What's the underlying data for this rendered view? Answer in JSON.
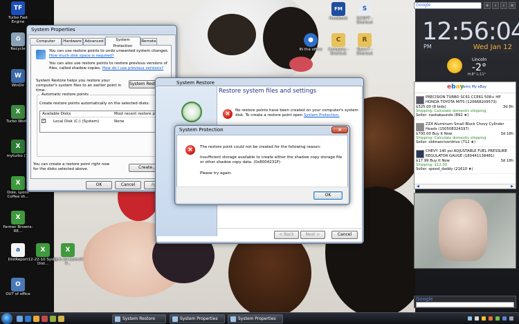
{
  "desktop": {
    "left_icons": [
      {
        "label": "Turbo Fast Engine",
        "color": "#1c4fb8",
        "glyph": "TF"
      },
      {
        "label": "Recycle",
        "color": "#8aa2b8",
        "glyph": "♻"
      },
      {
        "label": "WinDir",
        "color": "#3b6aa8",
        "glyph": "W"
      },
      {
        "label": "Turbo Works",
        "color": "#3b8a3f",
        "glyph": "X"
      },
      {
        "label": "myturbo (1)",
        "color": "#2f7a36",
        "glyph": "X"
      },
      {
        "label": "Dole, Lyons Coffee sh...",
        "color": "#3f9a3d",
        "glyph": "X"
      },
      {
        "label": "Farmer Browns-RE...",
        "color": "#3f9a3d",
        "glyph": "X"
      },
      {
        "label": "DistReport",
        "color": "#f4f4f4",
        "glyph": "a"
      },
      {
        "label": "12-22-10 Sysco Dist...",
        "color": "#3f9a3d",
        "glyph": "X"
      },
      {
        "label": "11-6-10 Eurovill P...",
        "color": "#3f9a3d",
        "glyph": "X"
      },
      {
        "label": "OUT of office",
        "color": "#4a79b5",
        "glyph": "O"
      }
    ],
    "top_icons": [
      {
        "label": "Foodbook",
        "glyph": "FM"
      },
      {
        "label": "SCRIPT - Shortcut",
        "glyph": "S"
      },
      {
        "label": "IN the office",
        "glyph": "●"
      },
      {
        "label": "Company - Shortcut",
        "glyph": "C"
      },
      {
        "label": "Ryan-T - Shortcut",
        "glyph": "R"
      }
    ]
  },
  "sidebar": {
    "search_label": "Google",
    "clock_time": "12:56:04",
    "ampm": "PM",
    "date": "Wed Jan 12",
    "weather_city": "Lincoln",
    "weather_temp": "-2°",
    "weather_hilo": "H:8° L:11°",
    "ebay": {
      "logo": "ebay",
      "links": "Items  My eBay",
      "items": [
        {
          "title": "PRECISION TURBO SC61 CCE61 508+ HP HONDA TOYOTA MITS (120668209573)",
          "price": "$325.00 (8 bids)",
          "time": "3d 8h",
          "shipping": "Shipping: Calculate domestic shipping",
          "seller": "Seller: naskabaundo (892 ★)"
        },
        {
          "title": "ZZ4 Aluminum Small Block Chevy Cylinder Heads (150508324197)",
          "price": "$700.00 Buy It Now",
          "time": "3d 18h",
          "shipping": "Shipping: Calculate domestic shipping",
          "seller": "Seller: oldmanriverdrive (712 ★)"
        },
        {
          "title": "CHEVY 140 psi ADJUSTABLE FUEL PRESSURE REGULATOR GAUGE (180441138481)",
          "price": "$17.99 Buy It Now",
          "time": "3d 18h",
          "shipping": "Shipping: $12.00",
          "seller": "Seller: speed_daddy (21610 ★)"
        }
      ],
      "prev": "◀",
      "next": "▶"
    },
    "google_label": "Google"
  },
  "system_properties": {
    "title": "System Properties",
    "tabs": [
      "Computer Name",
      "Hardware",
      "Advanced",
      "System Protection",
      "Remote"
    ],
    "intro1": "You can use restore points to undo unwanted system changes.",
    "intro1_link": "How much disk space is required?",
    "intro2": "You can also use restore points to restore previous versions of files, called shadow copies.",
    "intro2_link": "How do I use previous versions?",
    "restore_text": "System Restore helps you restore your computer's system files to an earlier point in time.",
    "restore_button": "System Restore...",
    "group_title": "Automatic restore points",
    "group_sub": "Create restore points automatically on the selected disks:",
    "col_disks": "Available Disks",
    "col_recent": "Most recent restore point",
    "disk_name": "Local Disk (C:) (System)",
    "disk_recent": "None",
    "create_text": "You can create a restore point right now for the disks selected above.",
    "create_button": "Create...",
    "ok": "OK",
    "cancel": "Cancel",
    "apply": "Apply"
  },
  "system_restore": {
    "title": "System Restore",
    "header": "Restore system files and settings",
    "message": "No restore points have been created on your computer's system disk. To create a restore point open",
    "message_link": "System Protection.",
    "back": "< Back",
    "next": "Next >",
    "cancel": "Cancel"
  },
  "protection_dialog": {
    "title": "System Protection",
    "message1": "The restore point could not be created for the following reason:",
    "message2": "Insufficient storage available to create either the shadow copy storage file or other shadow copy data. (0x8004231F)",
    "message3": "Please try again.",
    "ok": "OK"
  },
  "taskbar": {
    "tasks": [
      "System Restore",
      "System Properties",
      "System Properties"
    ]
  }
}
